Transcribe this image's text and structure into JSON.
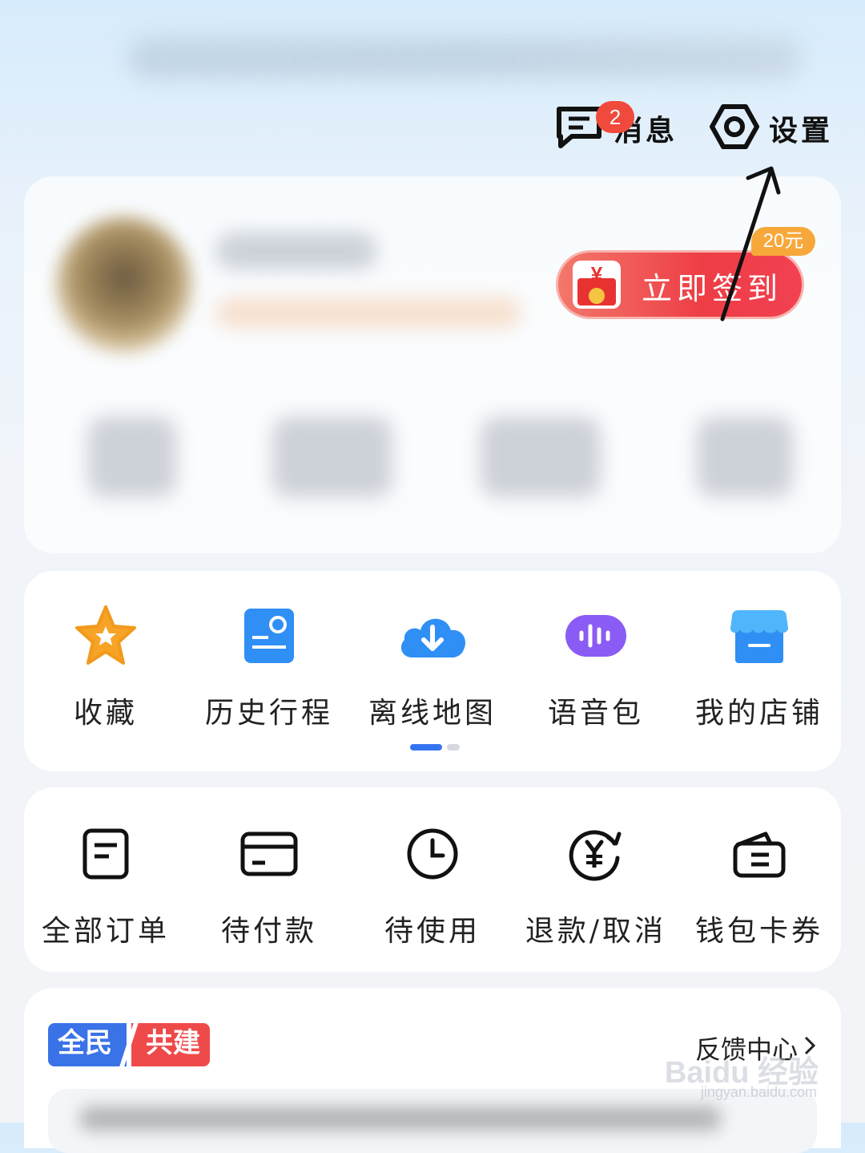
{
  "header": {
    "messages_label": "消息",
    "messages_badge": "2",
    "settings_label": "设置"
  },
  "profile": {
    "checkin_label": "立即签到",
    "checkin_icon_symbol": "¥",
    "checkin_reward": "20元"
  },
  "tools": {
    "items": [
      {
        "label": "收藏",
        "icon": "star-icon"
      },
      {
        "label": "历史行程",
        "icon": "trip-history-icon"
      },
      {
        "label": "离线地图",
        "icon": "cloud-download-icon"
      },
      {
        "label": "语音包",
        "icon": "voice-pack-icon"
      },
      {
        "label": "我的店铺",
        "icon": "store-icon"
      }
    ],
    "page_count": 2,
    "active_page": 1
  },
  "orders": {
    "items": [
      {
        "label": "全部订单",
        "icon": "order-list-icon"
      },
      {
        "label": "待付款",
        "icon": "card-icon"
      },
      {
        "label": "待使用",
        "icon": "clock-icon"
      },
      {
        "label": "退款/取消",
        "icon": "refund-icon"
      },
      {
        "label": "钱包卡券",
        "icon": "wallet-icon"
      }
    ]
  },
  "community": {
    "logo_part1": "全民",
    "logo_part2": "共建",
    "feedback_label": "反馈中心"
  },
  "watermark": {
    "brand": "Baidu 经验",
    "url": "jingyan.baidu.com"
  },
  "colors": {
    "accent_blue": "#3574f0",
    "badge_red": "#f04a3c",
    "checkin_red": "#ee3d45",
    "reward_orange": "#f7a83a"
  }
}
